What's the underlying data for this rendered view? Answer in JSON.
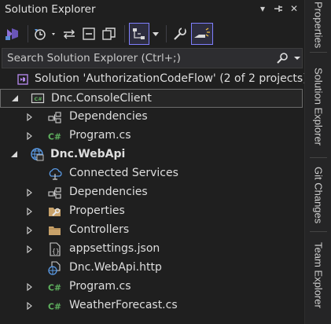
{
  "window": {
    "title": "Solution Explorer",
    "controls": {
      "dropdown": "▾",
      "pin": "⊣",
      "close": "✕"
    }
  },
  "toolbar": {
    "buttons": [
      "vs-switch-views-icon",
      "history-icon",
      "sync-icon",
      "collapse-all-icon",
      "show-all-files-icon",
      "tree-view-icon",
      "properties-wrench-icon",
      "preview-selected-icon"
    ]
  },
  "search": {
    "placeholder": "Search Solution Explorer (Ctrl+;)"
  },
  "tree": {
    "solution": {
      "label": "Solution 'AuthorizationCodeFlow' (2 of 2 projects)"
    },
    "console_project": {
      "label": "Dnc.ConsoleClient",
      "children": [
        {
          "label": "Dependencies",
          "icon": "dependencies-icon"
        },
        {
          "label": "Program.cs",
          "icon": "csharp-file-icon"
        }
      ]
    },
    "web_project": {
      "label": "Dnc.WebApi",
      "children": [
        {
          "label": "Connected Services",
          "icon": "connected-services-icon"
        },
        {
          "label": "Dependencies",
          "icon": "dependencies-icon"
        },
        {
          "label": "Properties",
          "icon": "properties-folder-icon"
        },
        {
          "label": "Controllers",
          "icon": "folder-icon"
        },
        {
          "label": "appsettings.json",
          "icon": "json-file-icon"
        },
        {
          "label": "Dnc.WebApi.http",
          "icon": "http-file-icon"
        },
        {
          "label": "Program.cs",
          "icon": "csharp-file-icon"
        },
        {
          "label": "WeatherForecast.cs",
          "icon": "csharp-file-icon"
        }
      ]
    }
  },
  "side_tabs": [
    "Properties",
    "Solution Explorer",
    "Git Changes",
    "Team Explorer"
  ],
  "colors": {
    "background": "#1f1f1f",
    "accent": "#7f7fff",
    "csharp_green": "#5fb35f",
    "folder": "#c8a26a",
    "vs_purple": "#8c6fd6"
  }
}
